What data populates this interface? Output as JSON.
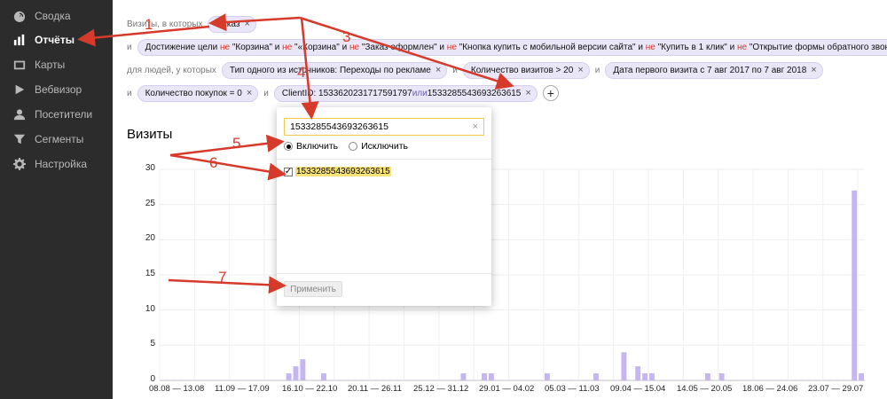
{
  "sidebar": {
    "items": [
      {
        "label": "Сводка",
        "icon": "dashboard-icon",
        "active": false
      },
      {
        "label": "Отчёты",
        "icon": "bar-chart-icon",
        "active": true
      },
      {
        "label": "Карты",
        "icon": "map-icon",
        "active": false
      },
      {
        "label": "Вебвизор",
        "icon": "play-icon",
        "active": false
      },
      {
        "label": "Посетители",
        "icon": "person-icon",
        "active": false
      },
      {
        "label": "Сегменты",
        "icon": "funnel-icon",
        "active": false
      },
      {
        "label": "Настройка",
        "icon": "gear-icon",
        "active": false
      }
    ]
  },
  "filters": {
    "row1": {
      "prefix": "Визиты, в которых",
      "chip": "Отказ"
    },
    "row2": {
      "conj": "и",
      "chip_parts": [
        {
          "text": "Достижение цели ",
          "neg": false
        },
        {
          "text": "не",
          "neg": true
        },
        {
          "text": " \"Корзина\" ",
          "neg": false
        },
        {
          "text": "и",
          "neg": false
        },
        {
          "text": " не",
          "neg": true
        },
        {
          "text": " \"«Корзина\" ",
          "neg": false
        },
        {
          "text": "и",
          "neg": false
        },
        {
          "text": " не",
          "neg": true
        },
        {
          "text": " \"Заказ оформлен\" ",
          "neg": false
        },
        {
          "text": "и",
          "neg": false
        },
        {
          "text": " не",
          "neg": true
        },
        {
          "text": " \"Кнопка купить с мобильной версии сайта\" ",
          "neg": false
        },
        {
          "text": "и",
          "neg": false
        },
        {
          "text": " не",
          "neg": true
        },
        {
          "text": " \"Купить в 1 клик\" ",
          "neg": false
        },
        {
          "text": "и",
          "neg": false
        },
        {
          "text": " не",
          "neg": true
        },
        {
          "text": " \"Открытие формы обратного звонк...",
          "neg": false
        }
      ]
    },
    "row3": {
      "prefix": "для людей, у которых",
      "chip1": "Тип одного из источников: Переходы по рекламе",
      "conj1": "и",
      "chip2": "Количество визитов > 20",
      "conj2": "и",
      "chip3": "Дата первого визита с 7 авг 2017 по 7 авг 2018"
    },
    "row4": {
      "conj1": "и",
      "chip1": "Количество покупок = 0",
      "conj2": "и",
      "chip2_a": "ClientID: 1533620231717591797 ",
      "chip2_or": "или",
      "chip2_b": " 1533285543693263615"
    },
    "close_glyph": "×",
    "plus_glyph": "+"
  },
  "chart_title": "Визиты",
  "popup": {
    "search_value": "1533285543693263615",
    "clear_glyph": "×",
    "include_label": "Включить",
    "exclude_label": "Исключить",
    "item_label": "1533285543693263615",
    "item_checked": true,
    "apply_label": "Применить"
  },
  "annotations": {
    "numbers": [
      "1",
      "3",
      "4",
      "5",
      "6",
      "7"
    ],
    "color": "#d63a2a"
  },
  "chart_data": {
    "type": "bar",
    "title": "Визиты",
    "ylim": [
      0,
      30
    ],
    "yticks": [
      0,
      5,
      10,
      15,
      20,
      25,
      30
    ],
    "ytick_labels": [
      "0",
      "5",
      "10",
      "15",
      "20",
      "25",
      "30"
    ],
    "xtick_labels": [
      "08.08 — 13.08",
      "11.09 — 17.09",
      "16.10 — 22.10",
      "20.11 — 26.11",
      "25.12 — 31.12",
      "29.01 — 04.02",
      "05.03 — 11.03",
      "09.04 — 15.04",
      "14.05 — 20.05",
      "18.06 — 24.06",
      "23.07 — 29.07"
    ],
    "values": [
      0,
      0,
      0,
      0,
      0,
      0,
      0,
      0,
      0,
      0,
      0,
      0,
      0,
      0,
      0,
      0,
      0,
      0,
      1,
      2,
      3,
      0,
      0,
      1,
      0,
      0,
      0,
      0,
      0,
      0,
      0,
      0,
      0,
      0,
      0,
      0,
      0,
      0,
      0,
      0,
      0,
      0,
      0,
      1,
      0,
      0,
      1,
      1,
      0,
      0,
      0,
      0,
      0,
      0,
      0,
      1,
      0,
      0,
      0,
      0,
      0,
      0,
      1,
      0,
      0,
      0,
      4,
      0,
      2,
      1,
      1,
      0,
      0,
      0,
      0,
      0,
      0,
      0,
      1,
      0,
      1,
      0,
      0,
      0,
      0,
      0,
      0,
      0,
      0,
      0,
      0,
      0,
      0,
      0,
      0,
      0,
      0,
      0,
      0,
      27,
      1
    ],
    "bar_color": "#c5b5f0",
    "grid": true
  }
}
